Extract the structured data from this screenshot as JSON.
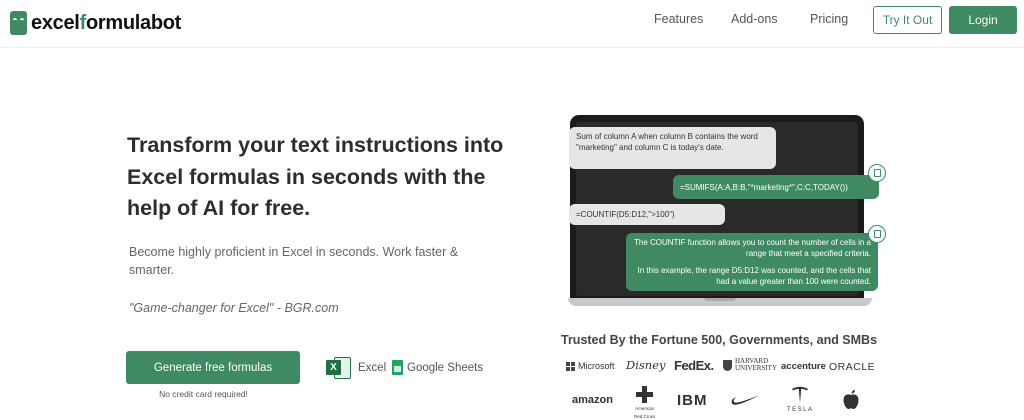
{
  "brand": {
    "logo_prefix": "excel",
    "logo_accent": "f",
    "logo_suffix": "ormulabot",
    "accent_color": "#3f8a63"
  },
  "nav": {
    "links": [
      "Features",
      "Add-ons",
      "Pricing"
    ],
    "try_label": "Try It Out",
    "login_label": "Login"
  },
  "hero": {
    "headline": "Transform your text instructions into Excel formulas in seconds with the help of AI for free.",
    "subtext": "Become highly proficient in Excel in seconds. Work faster & smarter.",
    "quote": "\"Game-changer for Excel\" - BGR.com",
    "cta_label": "Generate free formulas",
    "no_card": "No credit card required!",
    "badge_excel": "Excel",
    "badge_sheets": "Google Sheets"
  },
  "demo": {
    "user_msg_1": "Sum of column A when column B contains the word \"marketing\" and column C is today's date.",
    "ai_msg_1": "=SUMIFS(A:A,B:B,\"*marketing*\",C:C,TODAY())",
    "user_msg_2": "=COUNTIF(D5:D12,\">100\")",
    "ai_msg_2_p1": "The COUNTIF function allows you to count the number of cells in a range that meet a specified criteria.",
    "ai_msg_2_p2": "In this example, the range D5:D12 was counted, and the cells that had a value greater than 100 were counted."
  },
  "trusted": {
    "title": "Trusted By the Fortune 500, Governments, and SMBs",
    "microsoft": "Microsoft",
    "disney": "Disney",
    "fedex": "FedEx.",
    "harvard_1": "HARVARD",
    "harvard_2": "UNIVERSITY",
    "accenture": "accenture",
    "oracle": "ORACLE",
    "amazon": "amazon",
    "redcross_1": "American",
    "redcross_2": "Red Cross",
    "ibm": "IBM",
    "tesla": "TESLA"
  }
}
